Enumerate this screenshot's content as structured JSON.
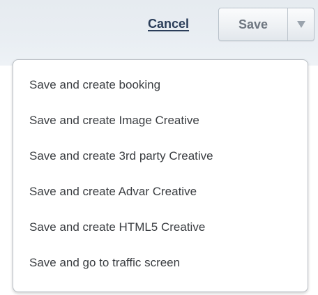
{
  "toolbar": {
    "cancel_label": "Cancel",
    "save_label": "Save"
  },
  "dropdown": {
    "items": [
      {
        "label": "Save and create booking"
      },
      {
        "label": "Save and create Image Creative"
      },
      {
        "label": "Save and create 3rd party Creative"
      },
      {
        "label": "Save and create Advar Creative"
      },
      {
        "label": "Save and create HTML5 Creative"
      },
      {
        "label": "Save and go to traffic screen"
      }
    ]
  },
  "icons": {
    "toggle": "chevron-down-icon"
  },
  "colors": {
    "toolbar_background": "#e9eef3",
    "cancel_link": "#2a3d59",
    "save_text": "#6e7680",
    "menu_text": "#3a3d41",
    "menu_border": "#b9bec4"
  }
}
